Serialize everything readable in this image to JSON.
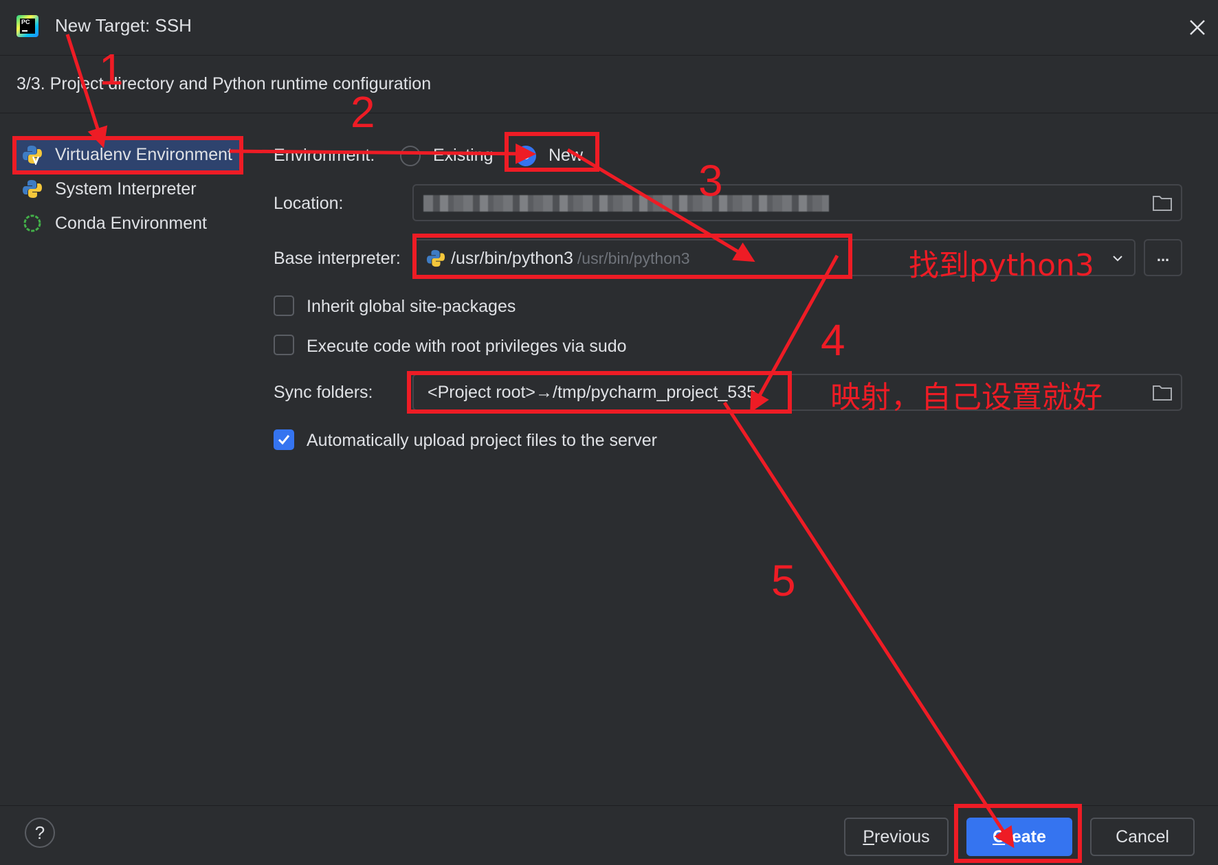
{
  "dialog": {
    "title": "New Target: SSH",
    "subtitle": "3/3. Project directory and Python runtime configuration",
    "logo_text": "PC"
  },
  "sidebar": {
    "items": [
      {
        "label": "Virtualenv Environment",
        "icon": "virtualenv-icon",
        "selected": true
      },
      {
        "label": "System Interpreter",
        "icon": "python-icon",
        "selected": false
      },
      {
        "label": "Conda Environment",
        "icon": "conda-icon",
        "selected": false
      }
    ]
  },
  "form": {
    "environment_label": "Environment:",
    "env_options": [
      "Existing",
      "New"
    ],
    "env_selected": "New",
    "location_label": "Location:",
    "base_interpreter_label": "Base interpreter:",
    "base_interpreter_value": "/usr/bin/python3",
    "base_interpreter_hint": "/usr/bin/python3",
    "browse_label": "...",
    "inherit_label": "Inherit global site-packages",
    "inherit_checked": false,
    "sudo_label": "Execute code with root privileges via sudo",
    "sudo_checked": false,
    "sync_label": "Sync folders:",
    "sync_value": "<Project root>→/tmp/pycharm_project_535",
    "auto_upload_label": "Automatically upload project files to the server",
    "auto_upload_checked": true
  },
  "footer": {
    "help": "?",
    "previous_first": "P",
    "previous_rest": "revious",
    "create_first": "C",
    "create_rest": "reate",
    "cancel": "Cancel"
  },
  "annotations": {
    "numbers": [
      "1",
      "2",
      "3",
      "4",
      "5"
    ],
    "note_interpreter": "找到python3",
    "note_sync": "映射，自己设置就好"
  },
  "colors": {
    "background": "#2b2d30",
    "accent": "#3574f0",
    "selection": "#2e436e",
    "annotation": "#ee1c25"
  }
}
